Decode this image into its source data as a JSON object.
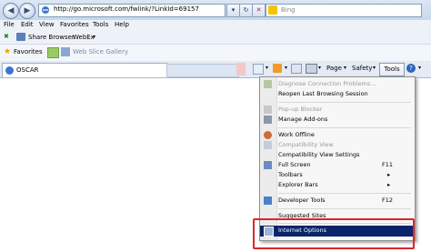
{
  "address_bar": {
    "url": "http://go.microsoft.com/fwlink/?LinkId=69157",
    "search_placeholder": "Bing"
  },
  "menu_bar": {
    "items": [
      "File",
      "Edit",
      "View",
      "Favorites",
      "Tools",
      "Help"
    ]
  },
  "links_bar": {
    "share_browser": "Share Browser",
    "webex": "WebEx"
  },
  "favorites_bar": {
    "favorites_label": "Favorites",
    "web_slice_gallery": "Web Slice Gallery"
  },
  "tab": {
    "title": "OSCAR"
  },
  "command_bar": {
    "page": "Page",
    "safety": "Safety",
    "tools": "Tools"
  },
  "tools_menu": {
    "items": [
      {
        "label": "Diagnose Connection Problems...",
        "enabled": false
      },
      {
        "label": "Reopen Last Browsing Session",
        "enabled": true
      },
      {
        "label": "Pop-up Blocker",
        "enabled": false
      },
      {
        "label": "Manage Add-ons",
        "enabled": true
      },
      {
        "label": "Work Offline",
        "enabled": true
      },
      {
        "label": "Compatibility View",
        "enabled": false
      },
      {
        "label": "Compatibility View Settings",
        "enabled": true
      },
      {
        "label": "Full Screen",
        "enabled": true,
        "shortcut": "F11"
      },
      {
        "label": "Toolbars",
        "enabled": true,
        "submenu": true
      },
      {
        "label": "Explorer Bars",
        "enabled": true,
        "submenu": true
      },
      {
        "label": "Developer Tools",
        "enabled": true,
        "shortcut": "F12"
      },
      {
        "label": "Suggested Sites",
        "enabled": true
      },
      {
        "label": "Internet Options",
        "enabled": true,
        "highlighted": true
      }
    ]
  },
  "colors": {
    "highlight": "#0a246a",
    "annotation_box": "#d9262c"
  }
}
